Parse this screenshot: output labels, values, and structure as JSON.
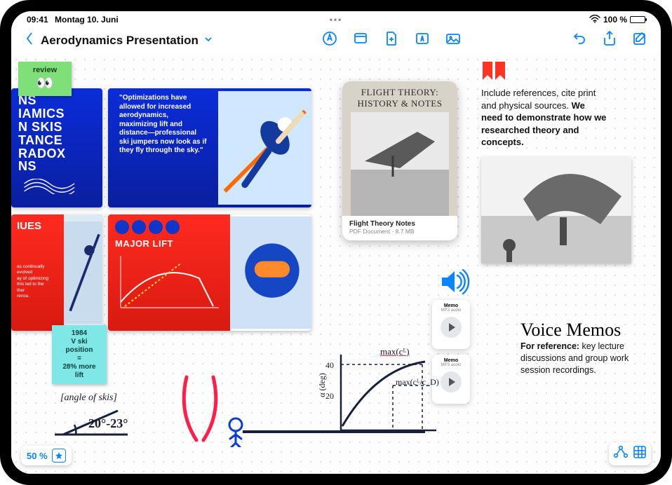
{
  "status": {
    "time": "09:41",
    "date": "Montag 10. Juni",
    "battery_text": "100 %"
  },
  "toolbar": {
    "board_title": "Aerodynamics Presentation"
  },
  "sticky_review": {
    "label": "review",
    "emoji": "👀"
  },
  "sticky_vski": {
    "line1": "1984",
    "line2": "V ski position",
    "line3": "=",
    "line4": "28% more lift"
  },
  "slides": {
    "blue1": {
      "l1": "NS",
      "l2": "IAMICS",
      "l3": "N SKIS",
      "l4": "TANCE",
      "l5": "RADOX",
      "l6": "NS"
    },
    "blue2_quote": "\"Optimizations have allowed for increased aerodynamics, maximizing lift and distance—professional ski jumpers now look as if they fly through the sky.\"",
    "red1": {
      "title": "IUES",
      "body": "as continually evolved\nay of optimizing\nthis led to the\nther\nrence."
    },
    "red2": {
      "title": "MAJOR LIFT"
    }
  },
  "pdf": {
    "cover_title_1": "FLIGHT THEORY:",
    "cover_title_2": "HISTORY & NOTES",
    "filename": "Flight Theory Notes",
    "filetype": "PDF Document",
    "filesize": "8.7 MB"
  },
  "ref_text": {
    "line1": "Include references, cite print and physical sources.",
    "line2": "We need to demonstrate how we researched theory and concepts."
  },
  "voice": {
    "title": "Voice Memos",
    "body_bold": "For reference:",
    "body_rest": " key lecture discussions and group work session recordings."
  },
  "audio": {
    "memo1": {
      "title": "Memo",
      "sub": "MP3 audio"
    },
    "memo2": {
      "title": "Memo",
      "sub": "MP3 audio"
    }
  },
  "hand_angle": {
    "label": "[angle of skis]",
    "value": "20°-23°"
  },
  "graph": {
    "ymax": "40",
    "ymid": "20",
    "ylabel": "α (deg)",
    "ann1": "max(cᴸ)",
    "ann2": "max(cᴸ/c_D)"
  },
  "zoom": {
    "level": "50 %"
  }
}
